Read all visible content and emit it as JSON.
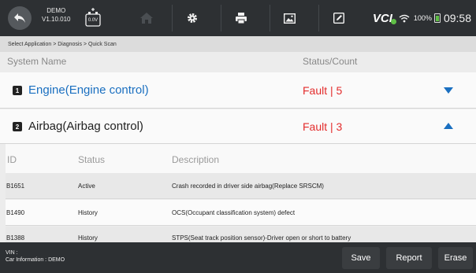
{
  "app": {
    "demo_label": "DEMO",
    "version": "V1.10.010",
    "battery_voltage": "0.0V"
  },
  "status": {
    "vci_label": "VCI",
    "battery_percent": "100%",
    "time": "09:58"
  },
  "breadcrumb": "Select Application > Diagnosis > Quick Scan",
  "columns": {
    "system_name": "System Name",
    "status_count": "Status/Count"
  },
  "systems": [
    {
      "number": "1",
      "name": "Engine(Engine control)",
      "status": "Fault | 5",
      "expanded": false,
      "name_color": "#1a6fc0"
    },
    {
      "number": "2",
      "name": "Airbag(Airbag control)",
      "status": "Fault | 3",
      "expanded": true,
      "name_color": "#222222"
    }
  ],
  "dtc_table": {
    "headers": {
      "id": "ID",
      "status": "Status",
      "description": "Description"
    },
    "rows": [
      {
        "id": "B1651",
        "status": "Active",
        "description": "Crash recorded in driver side airbag(Replace SRSCM)"
      },
      {
        "id": "B1490",
        "status": "History",
        "description": "OCS(Occupant classification system) defect"
      },
      {
        "id": "B1388",
        "status": "History",
        "description": "STPS(Seat track position sensor)-Driver open or short to battery"
      }
    ]
  },
  "footer": {
    "vin_label": "VIN :",
    "car_info": "Car Information : DEMO",
    "save_label": "Save",
    "report_label": "Report",
    "erase_label": "Erase"
  },
  "colors": {
    "topbar": "#2d3033",
    "fault": "#e32c2c",
    "accent": "#1a6fc0"
  },
  "icons": [
    "back-icon",
    "battery-icon",
    "home-icon",
    "settings-icon",
    "print-icon",
    "screenshot-icon",
    "edit-icon",
    "wifi-icon"
  ]
}
